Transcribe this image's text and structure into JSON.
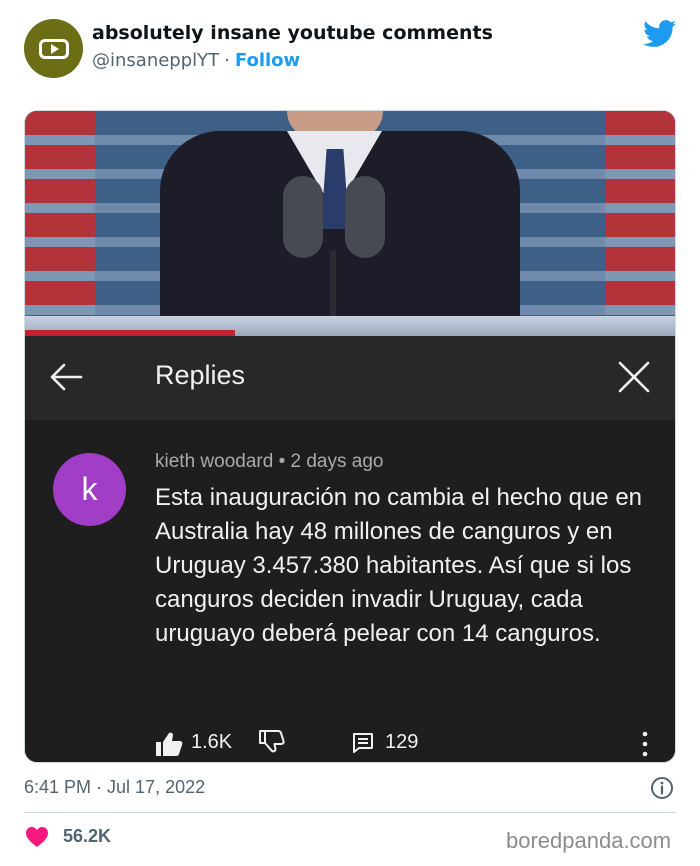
{
  "header": {
    "display_name": "absolutely insane youtube comments",
    "handle": "@insanepplYT",
    "separator": "·",
    "follow_label": "Follow",
    "avatar_color": "#6b6e14",
    "brand_color": "#1d9bf0"
  },
  "media": {
    "panel_title": "Replies",
    "back_icon": "arrow-left-icon",
    "close_icon": "close-icon",
    "comment": {
      "avatar_letter": "k",
      "avatar_color": "#a23dc8",
      "author": "kieth woodard",
      "age": "2 days ago",
      "meta_separator": "•",
      "text": "Esta inauguración no cambia el hecho que en Australia hay 48 millones de canguros y en Uruguay 3.457.380 habitantes. Así que si los canguros deciden invadir Uruguay, cada uruguayo deberá pelear con 14 canguros.",
      "likes": "1.6K",
      "replies": "129"
    }
  },
  "footer": {
    "timestamp": "6:41 PM · Jul 17, 2022",
    "like_total": "56.2K",
    "heart_color": "#f91880",
    "watermark": "boredpanda.com"
  }
}
